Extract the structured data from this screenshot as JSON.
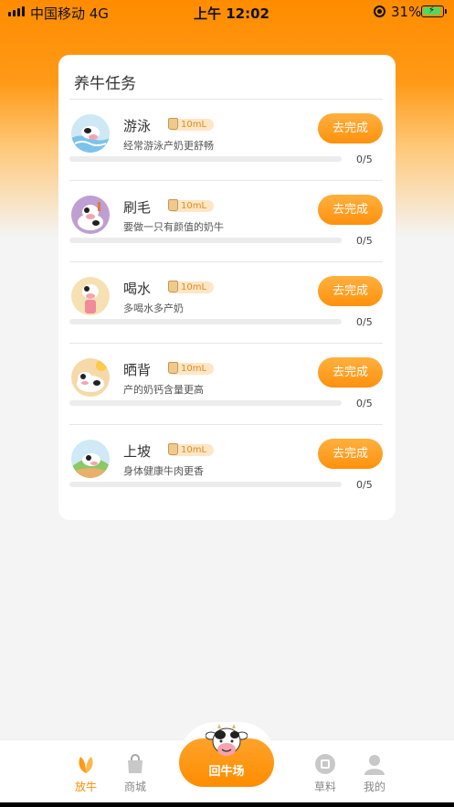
{
  "status_bar": {
    "carrier": "中国移动 4G",
    "time": "上午 12:02",
    "battery": "31%"
  },
  "card": {
    "title": "养牛任务",
    "tasks": [
      {
        "name": "游泳",
        "reward": "10mL",
        "desc": "经常游泳产奶更舒畅",
        "button": "去完成",
        "progress": "0/5",
        "done_fraction": 0,
        "icon": "swimming-cow-icon"
      },
      {
        "name": "刷毛",
        "reward": "10mL",
        "desc": "要做一只有颜值的奶牛",
        "button": "去完成",
        "progress": "0/5",
        "done_fraction": 0,
        "icon": "brushing-cow-icon"
      },
      {
        "name": "喝水",
        "reward": "10mL",
        "desc": "多喝水多产奶",
        "button": "去完成",
        "progress": "0/5",
        "done_fraction": 0,
        "icon": "drinking-cow-icon"
      },
      {
        "name": "晒背",
        "reward": "10mL",
        "desc": "产的奶钙含量更高",
        "button": "去完成",
        "progress": "0/5",
        "done_fraction": 0,
        "icon": "sunbathing-cow-icon"
      },
      {
        "name": "上坡",
        "reward": "10mL",
        "desc": "身体健康牛肉更香",
        "button": "去完成",
        "progress": "0/5",
        "done_fraction": 0,
        "icon": "hill-cow-icon"
      }
    ]
  },
  "tabbar": {
    "items": [
      {
        "label": "放牛",
        "icon": "leaf-icon",
        "active": true
      },
      {
        "label": "商城",
        "icon": "shopping-bag-icon",
        "active": false
      },
      {
        "label": "草料",
        "icon": "grass-feed-icon",
        "active": false
      },
      {
        "label": "我的",
        "icon": "user-icon",
        "active": false
      }
    ],
    "center_label": "回牛场",
    "center_icon": "cow-head-icon"
  },
  "colors": {
    "accent": "#ff8c00",
    "button": "#ff9a17",
    "reward_bg": "#ffe6c6"
  }
}
